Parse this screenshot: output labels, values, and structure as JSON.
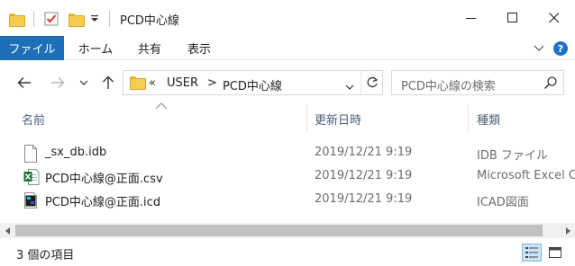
{
  "window": {
    "title": "PCD中心線",
    "title_separator": "|",
    "buttons": [
      "minimize",
      "maximize",
      "close"
    ]
  },
  "ribbon": {
    "tabs": [
      {
        "label": "ファイル",
        "active": true
      },
      {
        "label": "ホーム"
      },
      {
        "label": "共有"
      },
      {
        "label": "表示"
      }
    ]
  },
  "address": {
    "overflow": "«",
    "crumbs": [
      "USER",
      "PCD中心線"
    ],
    "separator": ">"
  },
  "search": {
    "placeholder": "PCD中心線の検索"
  },
  "columns": {
    "name": "名前",
    "date": "更新日時",
    "type": "種類"
  },
  "files": [
    {
      "name": "_sx_db.idb",
      "date": "2019/12/21 9:19",
      "type": "IDB ファイル",
      "icon": "generic-file-icon"
    },
    {
      "name": "PCD中心線@正面.csv",
      "date": "2019/12/21 9:19",
      "type": "Microsoft Excel C",
      "icon": "excel-csv-icon"
    },
    {
      "name": "PCD中心線@正面.icd",
      "date": "2019/12/21 9:19",
      "type": "ICAD図面",
      "icon": "icad-file-icon"
    }
  ],
  "status": {
    "item_count": "3 個の項目"
  },
  "colors": {
    "file_tab": "#1d6fb8",
    "folder": "#f5cd4f",
    "header_text": "#4c607a",
    "secondary_text": "#6d6d6d",
    "selected_view": "#cce4f7"
  }
}
